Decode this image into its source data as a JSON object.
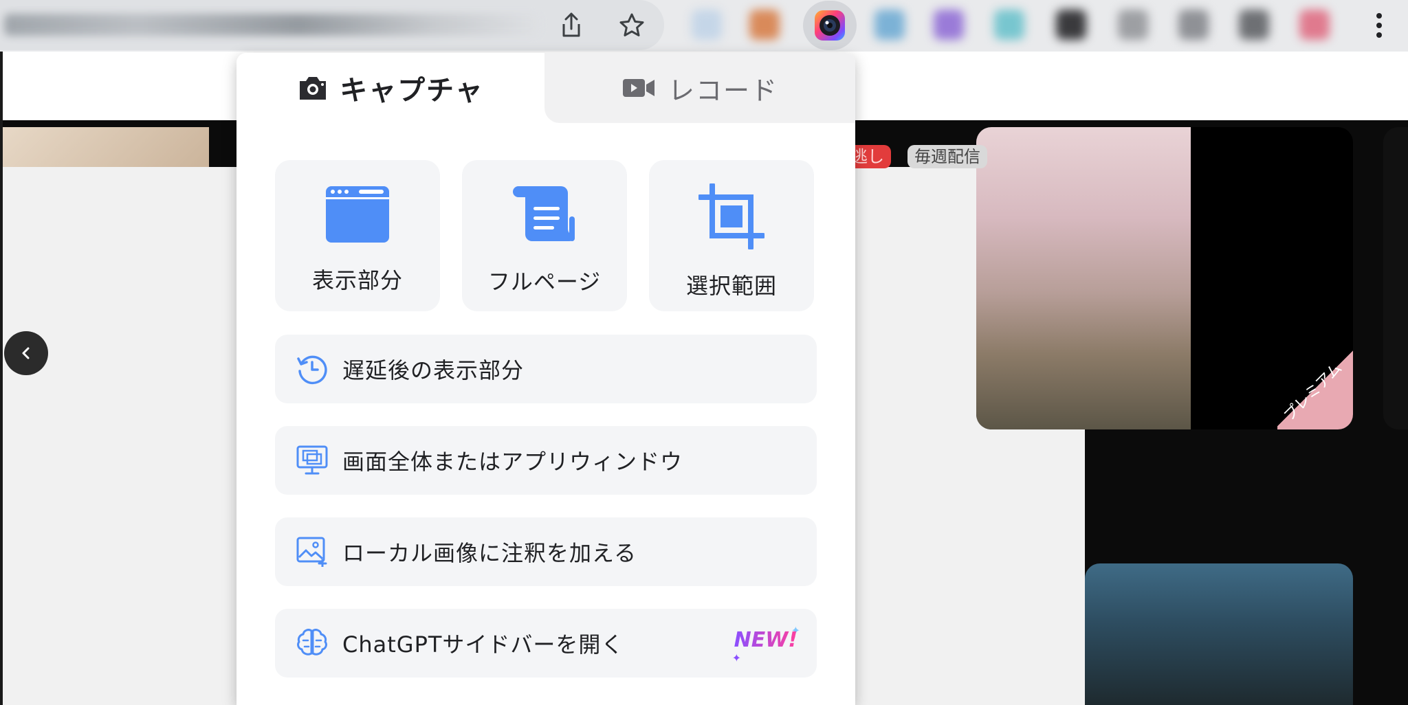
{
  "browser": {
    "toolbar_buttons": {
      "share_icon": "share-icon",
      "bookmark_icon": "star-icon",
      "menu_icon": "more-vert-icon"
    },
    "active_extension_icon": "camera-lens-icon"
  },
  "page": {
    "badges": [
      "逃し",
      "毎週配信"
    ],
    "ribbon_text": "プレミアム"
  },
  "popup": {
    "tabs": [
      {
        "label": "キャプチャ",
        "icon": "camera-icon",
        "active": true
      },
      {
        "label": "レコード",
        "icon": "video-icon",
        "active": false
      }
    ],
    "tiles": [
      {
        "label": "表示部分",
        "icon": "browser-window-icon"
      },
      {
        "label": "フルページ",
        "icon": "scroll-page-icon"
      },
      {
        "label": "選択範囲",
        "icon": "crop-icon"
      }
    ],
    "rows": [
      {
        "label": "遅延後の表示部分",
        "icon": "timer-icon"
      },
      {
        "label": "画面全体またはアプリウィンドウ",
        "icon": "monitor-icon"
      },
      {
        "label": "ローカル画像に注釈を加える",
        "icon": "image-annotate-icon"
      },
      {
        "label": "ChatGPTサイドバーを開く",
        "icon": "brain-icon",
        "badge": "NEW!"
      }
    ]
  },
  "colors": {
    "accent": "#4f8ef7",
    "tile_bg": "#f4f5f7",
    "tab_inactive_bg": "#f1f1f2"
  }
}
